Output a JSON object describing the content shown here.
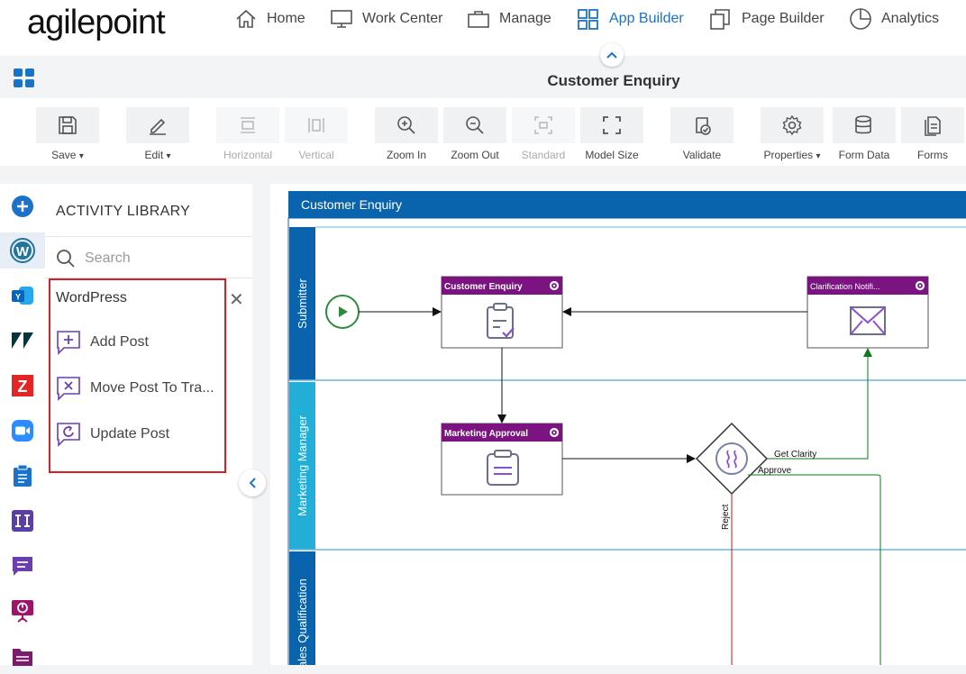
{
  "brand": {
    "logo_text": "agilepoint"
  },
  "nav": {
    "items": [
      {
        "label": "Home",
        "icon": "home-icon"
      },
      {
        "label": "Work Center",
        "icon": "monitor-icon"
      },
      {
        "label": "Manage",
        "icon": "briefcase-icon"
      },
      {
        "label": "App Builder",
        "icon": "grid-icon",
        "active": true
      },
      {
        "label": "Page Builder",
        "icon": "pages-icon"
      },
      {
        "label": "Analytics",
        "icon": "pie-chart-icon"
      }
    ]
  },
  "page": {
    "title": "Customer Enquiry"
  },
  "toolbar": {
    "save": "Save",
    "edit": "Edit",
    "horizontal": "Horizontal",
    "vertical": "Vertical",
    "zoom_in": "Zoom In",
    "zoom_out": "Zoom Out",
    "standard": "Standard",
    "model_size": "Model Size",
    "validate": "Validate",
    "properties": "Properties",
    "form_data": "Form Data",
    "forms": "Forms"
  },
  "library": {
    "title": "ACTIVITY LIBRARY",
    "search_placeholder": "Search",
    "group": {
      "title": "WordPress",
      "activities": [
        {
          "label": "Add Post",
          "icon": "add-post-icon"
        },
        {
          "label": "Move Post To Tra...",
          "icon": "trash-post-icon"
        },
        {
          "label": "Update Post",
          "icon": "update-post-icon"
        }
      ]
    }
  },
  "rail": {
    "items": [
      "add-icon",
      "wordpress-icon",
      "yammer-icon",
      "zendesk-icon",
      "zoho-icon",
      "zoom-icon",
      "clipboard-icon",
      "text-cursor-icon",
      "chat-icon",
      "presentation-icon",
      "folder-icon"
    ]
  },
  "process": {
    "pool_title": "Customer Enquiry",
    "lanes": [
      "Submitter",
      "Marketing Manager",
      "Sales Qualification"
    ],
    "activities": {
      "customer_enquiry": "Customer Enquiry",
      "clarification": "Clarification Notifi...",
      "marketing_approval": "Marketing Approval"
    },
    "connectors": {
      "get_clarity": "Get Clarity",
      "approve": "Approve",
      "reject": "Reject"
    }
  },
  "colors": {
    "accent": "#1a73c9",
    "pool_header": "#0a64ad",
    "lane_submitter": "#0a64ad",
    "lane_marketing": "#22aed6",
    "activity_header": "#7b1481",
    "start_event": "#2e8b3d",
    "highlight_border": "#d71f26"
  }
}
